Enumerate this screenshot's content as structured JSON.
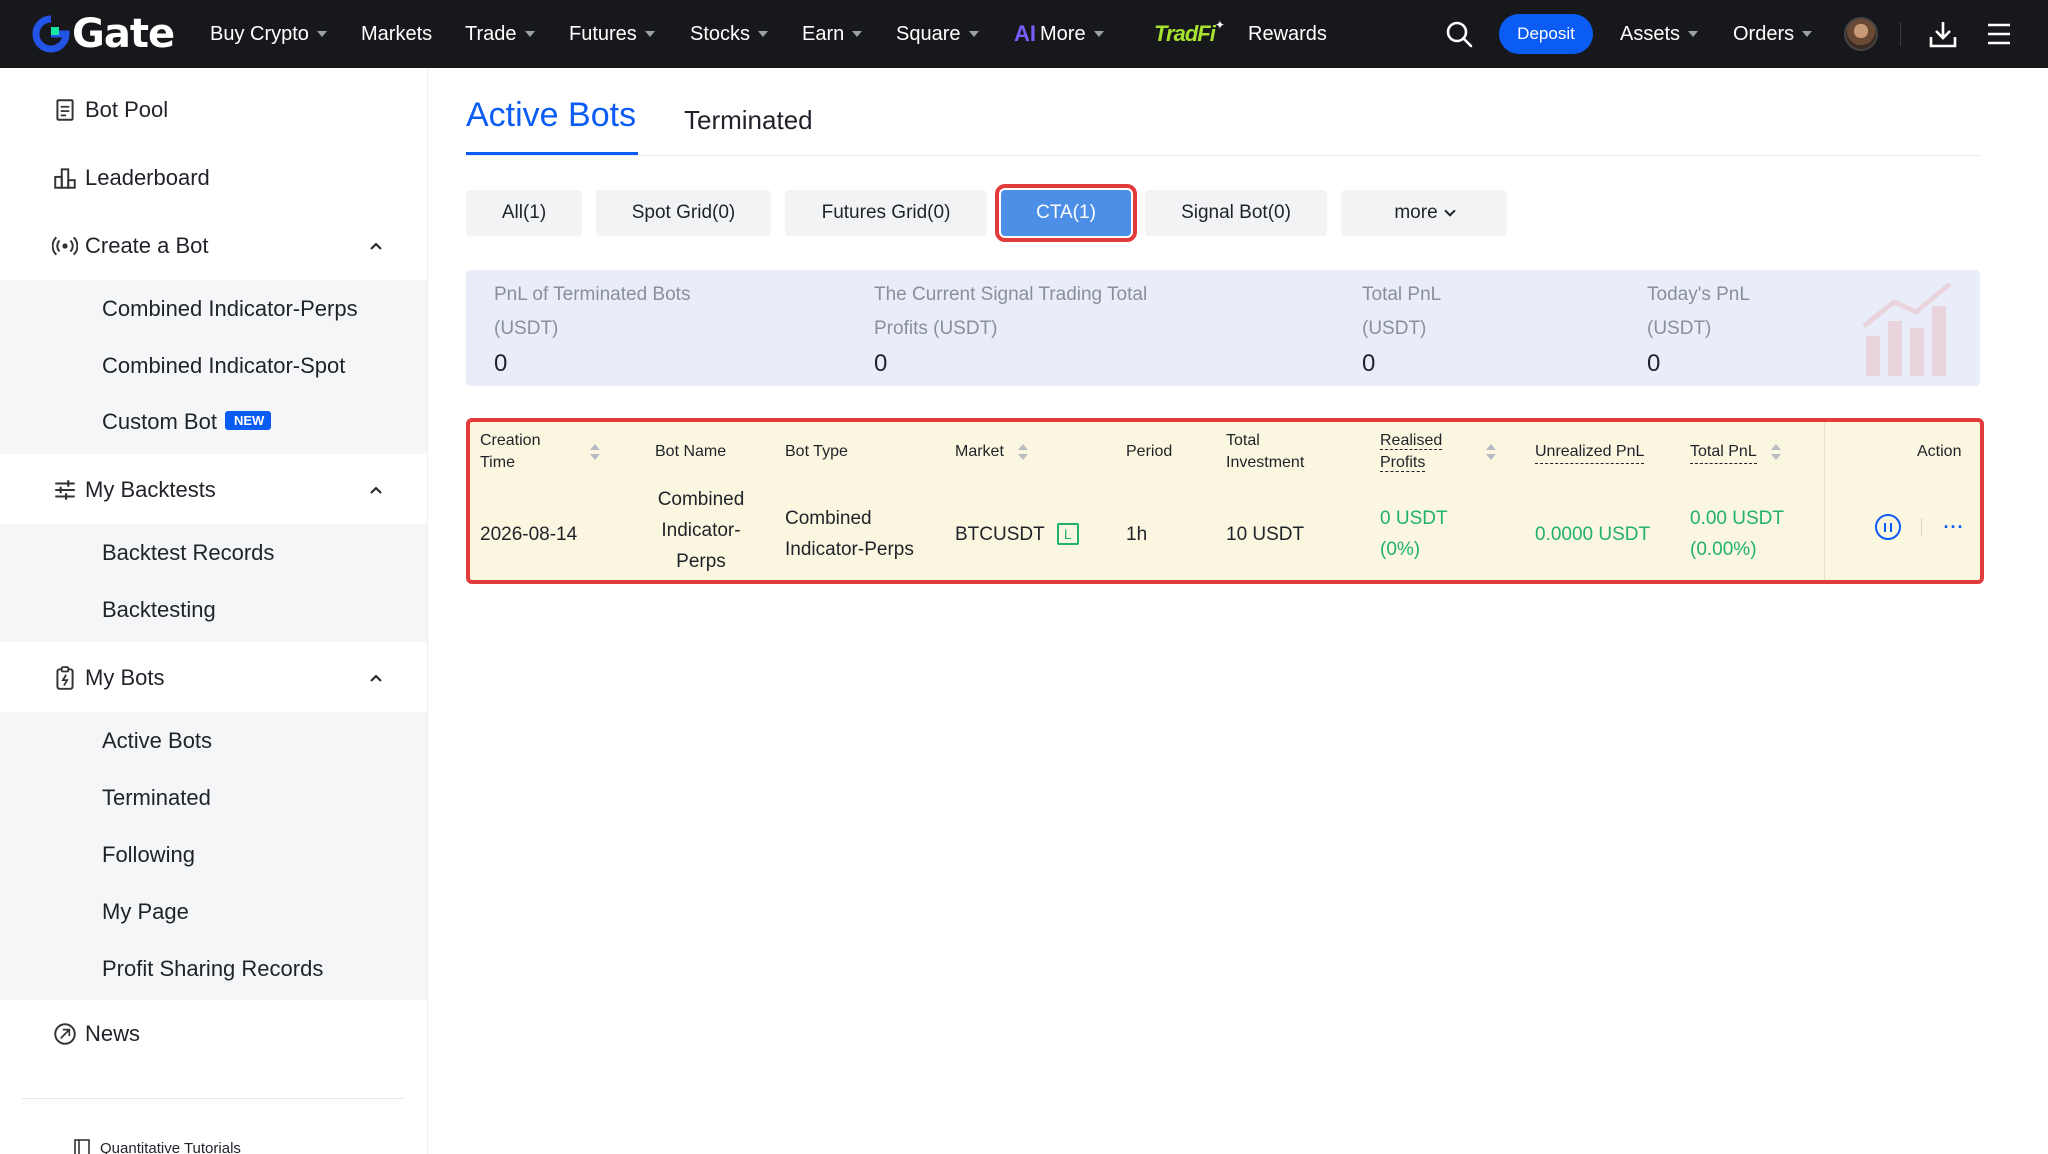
{
  "header": {
    "logo_text": "Gate",
    "nav": [
      {
        "label": "Buy Crypto",
        "caret": true
      },
      {
        "label": "Markets",
        "caret": false
      },
      {
        "label": "Trade",
        "caret": true
      },
      {
        "label": "Futures",
        "caret": true
      },
      {
        "label": "Stocks",
        "caret": true
      },
      {
        "label": "Earn",
        "caret": true
      },
      {
        "label": "Square",
        "caret": true
      },
      {
        "label": "More",
        "caret": true
      },
      {
        "label": "TradFi",
        "caret": false
      },
      {
        "label": "Rewards",
        "caret": false
      }
    ],
    "ai_glyph": "AI",
    "deposit_label": "Deposit",
    "assets_label": "Assets",
    "orders_label": "Orders",
    "icons": [
      "search-icon",
      "avatar",
      "download-icon",
      "menu-icon"
    ]
  },
  "sidebar": {
    "bot_pool": "Bot Pool",
    "leaderboard": "Leaderboard",
    "create_bot": "Create a Bot",
    "create_items": [
      "Combined Indicator-Perps",
      "Combined Indicator-Spot",
      "Custom Bot"
    ],
    "new_badge": "NEW",
    "my_backtests": "My Backtests",
    "backtest_items": [
      "Backtest Records",
      "Backtesting"
    ],
    "my_bots": "My Bots",
    "bot_items": [
      "Active Bots",
      "Terminated",
      "Following",
      "My Page",
      "Profit Sharing Records"
    ],
    "news": "News",
    "footer_link": "Quantitative Tutorials"
  },
  "main": {
    "tabs": {
      "active": "Active Bots",
      "other": "Terminated"
    },
    "filters": [
      "All(1)",
      "Spot Grid(0)",
      "Futures Grid(0)",
      "CTA(1)",
      "Signal Bot(0)",
      "more"
    ],
    "selected_filter": "CTA(1)",
    "summary": [
      {
        "label1": "PnL of Terminated Bots",
        "label2": "(USDT)",
        "value": "0"
      },
      {
        "label1": "The Current Signal Trading Total",
        "label2": "Profits (USDT)",
        "value": "0"
      },
      {
        "label1": "Total PnL",
        "label2": "(USDT)",
        "value": "0"
      },
      {
        "label1": "Today's PnL",
        "label2": "(USDT)",
        "value": "0"
      }
    ],
    "table": {
      "headers": {
        "creation_time_1": "Creation",
        "creation_time_2": "Time",
        "bot_name": "Bot Name",
        "bot_type": "Bot Type",
        "market": "Market",
        "period": "Period",
        "total_investment_1": "Total",
        "total_investment_2": "Investment",
        "realised_1": "Realised",
        "realised_2": "Profits",
        "unrealized": "Unrealized PnL",
        "total_pnl": "Total PnL",
        "action": "Action"
      },
      "row": {
        "creation_time": "2026-08-14",
        "bot_name_1": "Combined",
        "bot_name_2": "Indicator-",
        "bot_name_3": "Perps",
        "bot_type_1": "Combined",
        "bot_type_2": "Indicator-Perps",
        "market": "BTCUSDT",
        "market_badge": "L",
        "period": "1h",
        "total_investment": "10 USDT",
        "realised_value": "0 USDT",
        "realised_pct": "(0%)",
        "unrealized": "0.0000 USDT",
        "total_pnl_value": "0.00 USDT",
        "total_pnl_pct": "(0.00%)",
        "more_glyph": "···"
      }
    }
  },
  "colors": {
    "accent": "#0a5cf5",
    "profit": "#20b26c",
    "highlight": "#e23b3b",
    "row_bg": "#fbf6e0"
  }
}
